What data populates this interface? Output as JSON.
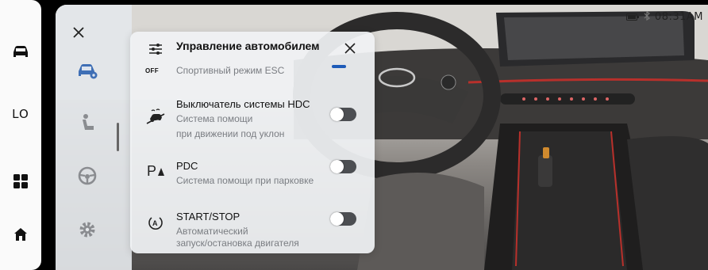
{
  "status": {
    "time": "08:31AM",
    "icons": [
      "battery-icon",
      "bluetooth-icon"
    ]
  },
  "rail": {
    "items": [
      {
        "name": "car",
        "icon": "car-icon"
      },
      {
        "name": "lo",
        "label": "LO"
      },
      {
        "name": "apps",
        "icon": "apps-grid-icon"
      },
      {
        "name": "home",
        "icon": "home-icon"
      }
    ]
  },
  "settings_sidebar": {
    "icons": [
      "car-settings-icon",
      "seat-icon",
      "steering-wheel-icon",
      "gear-icon"
    ]
  },
  "popup": {
    "title": "Управление автомобилем",
    "rows": [
      {
        "badge": "OFF",
        "title": "",
        "subtitle": "Спортивный режим ESC",
        "icon": "off-icon",
        "state": "partial"
      },
      {
        "title": "Выключатель системы HDC",
        "subtitle_lines": [
          "Система помощи",
          "при движении под уклон"
        ],
        "icon": "hill-descent-icon",
        "enabled": false
      },
      {
        "title": "PDC",
        "subtitle_lines": [
          "Система помощи при парковке"
        ],
        "icon": "parking-sensor-icon",
        "enabled": false
      },
      {
        "title": "START/STOP",
        "subtitle_lines": [
          "Автоматический",
          "запуск/остановка двигателя"
        ],
        "icon": "auto-start-stop-icon",
        "enabled": false
      }
    ]
  },
  "colors": {
    "accent": "#1e5bb8",
    "toggle_off": "#4c4e52",
    "panel": "#eef0f2",
    "rail": "#fafafa"
  }
}
